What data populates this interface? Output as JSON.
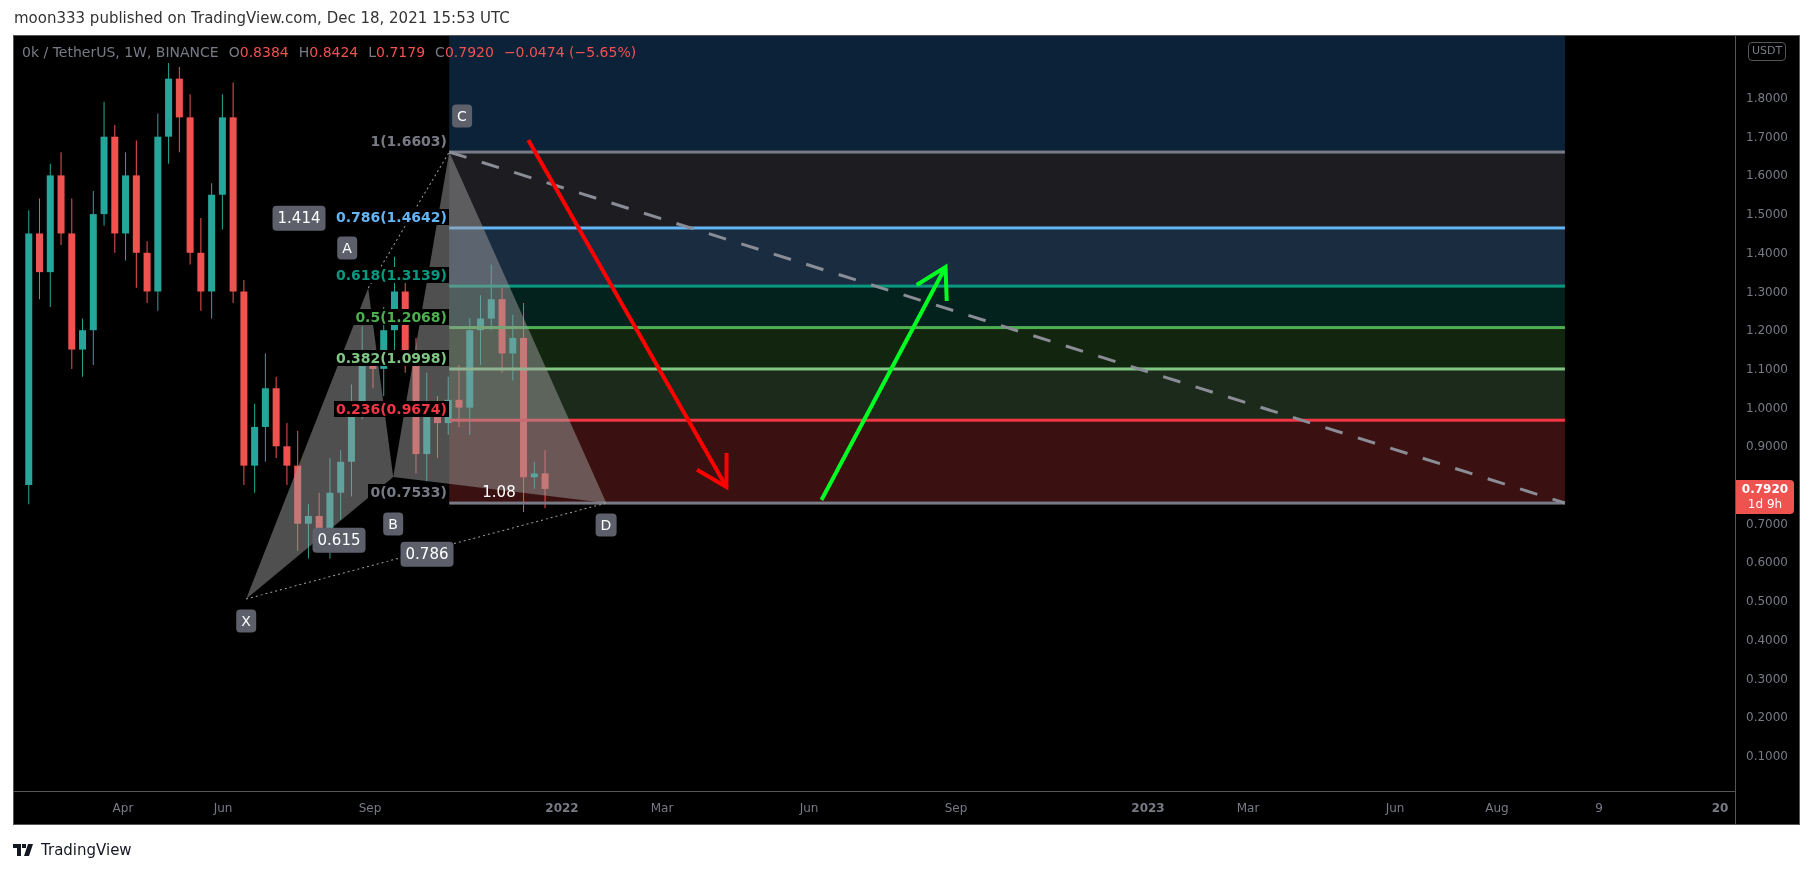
{
  "header": {
    "text": "moon333 published on TradingView.com, Dec 18, 2021 15:53 UTC"
  },
  "legend": {
    "symbol": "0k / TetherUS, 1W, BINANCE",
    "values": [
      {
        "key": "O",
        "value": "0.8384"
      },
      {
        "key": "H",
        "value": "0.8424"
      },
      {
        "key": "L",
        "value": "0.7179"
      },
      {
        "key": "C",
        "value": "0.7920"
      }
    ],
    "change": "−0.0474 (−5.65%)"
  },
  "fib_levels": [
    {
      "label": "1(1.6603)",
      "color": "#787b86"
    },
    {
      "label": "0.786(1.4642)",
      "color": "#64b5f6"
    },
    {
      "label": "0.618(1.3139)",
      "color": "#089981"
    },
    {
      "label": "0.5(1.2068)",
      "color": "#4caf50"
    },
    {
      "label": "0.382(1.0998)",
      "color": "#81c784"
    },
    {
      "label": "0.236(0.9674)",
      "color": "#f23645"
    },
    {
      "label": "0(0.7533)",
      "color": "#787b86"
    }
  ],
  "pattern_points": [
    {
      "label": "X"
    },
    {
      "label": "A"
    },
    {
      "label": "B"
    },
    {
      "label": "C"
    },
    {
      "label": "D"
    }
  ],
  "ratio_labels": [
    {
      "label": "0.615"
    },
    {
      "label": "0.786"
    },
    {
      "label": "1.414"
    },
    {
      "label": "1.08"
    }
  ],
  "price_axis": {
    "unit": "USDT",
    "labels": [
      "1.8000",
      "1.7000",
      "1.6000",
      "1.5000",
      "1.4000",
      "1.3000",
      "1.2000",
      "1.1000",
      "1.0000",
      "0.9000",
      "0.7000",
      "0.6000",
      "0.5000",
      "0.4000",
      "0.3000",
      "0.2000",
      "0.1000"
    ],
    "last_price": {
      "value": "0.7920",
      "countdown": "1d 9h"
    }
  },
  "time_axis": {
    "labels": [
      {
        "label": "Apr",
        "kind": "month"
      },
      {
        "label": "Jun",
        "kind": "month"
      },
      {
        "label": "Sep",
        "kind": "month"
      },
      {
        "label": "2022",
        "kind": "year"
      },
      {
        "label": "Mar",
        "kind": "month"
      },
      {
        "label": "Jun",
        "kind": "month"
      },
      {
        "label": "Sep",
        "kind": "month"
      },
      {
        "label": "2023",
        "kind": "year"
      },
      {
        "label": "Mar",
        "kind": "month"
      },
      {
        "label": "Jun",
        "kind": "month"
      },
      {
        "label": "Aug",
        "kind": "month"
      },
      {
        "label": "9",
        "kind": "month"
      },
      {
        "label": "20",
        "kind": "year"
      }
    ]
  },
  "footer": {
    "brand": "TradingView"
  }
}
